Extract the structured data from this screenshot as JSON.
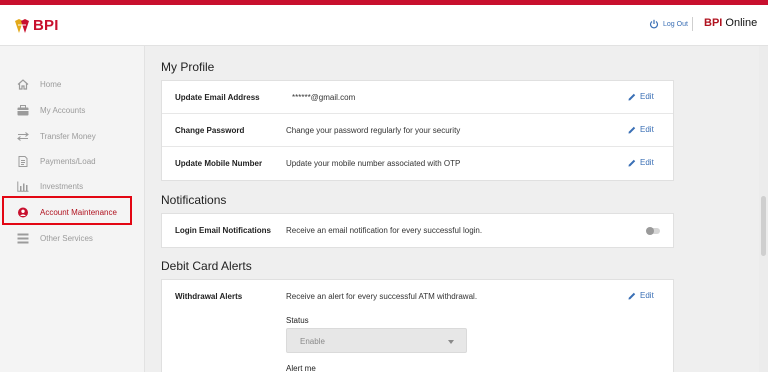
{
  "header": {
    "brand": "BPI",
    "logout_label": "Log Out",
    "online_brand": "BPI",
    "online_suffix": " Online"
  },
  "sidebar": {
    "items": [
      {
        "label": "Home",
        "icon": "home-icon"
      },
      {
        "label": "My Accounts",
        "icon": "wallet-icon"
      },
      {
        "label": "Transfer Money",
        "icon": "transfer-icon"
      },
      {
        "label": "Payments/Load",
        "icon": "document-icon"
      },
      {
        "label": "Investments",
        "icon": "bar-chart-icon"
      },
      {
        "label": "Account Maintenance",
        "icon": "user-circle-icon",
        "active": true
      },
      {
        "label": "Other Services",
        "icon": "list-icon"
      }
    ]
  },
  "profile": {
    "title": "My Profile",
    "rows": [
      {
        "label": "Update Email Address",
        "value": "******@gmail.com",
        "action": "Edit"
      },
      {
        "label": "Change Password",
        "value": "Change your password regularly for your security",
        "action": "Edit"
      },
      {
        "label": "Update Mobile Number",
        "value": "Update your mobile number associated with OTP",
        "action": "Edit"
      }
    ]
  },
  "notifications": {
    "title": "Notifications",
    "rows": [
      {
        "label": "Login Email Notifications",
        "value": "Receive an email notification for every successful login.",
        "enabled": false
      }
    ]
  },
  "debit_alerts": {
    "title": "Debit Card Alerts",
    "withdrawal": {
      "label": "Withdrawal Alerts",
      "value": "Receive an alert for every successful ATM withdrawal.",
      "action": "Edit",
      "status_label": "Status",
      "status_value": "Enable",
      "alert_me_label": "Alert me"
    }
  },
  "colors": {
    "brand_red": "#c8102e",
    "link_blue": "#3a6fb5",
    "highlight_red": "#e30613"
  }
}
